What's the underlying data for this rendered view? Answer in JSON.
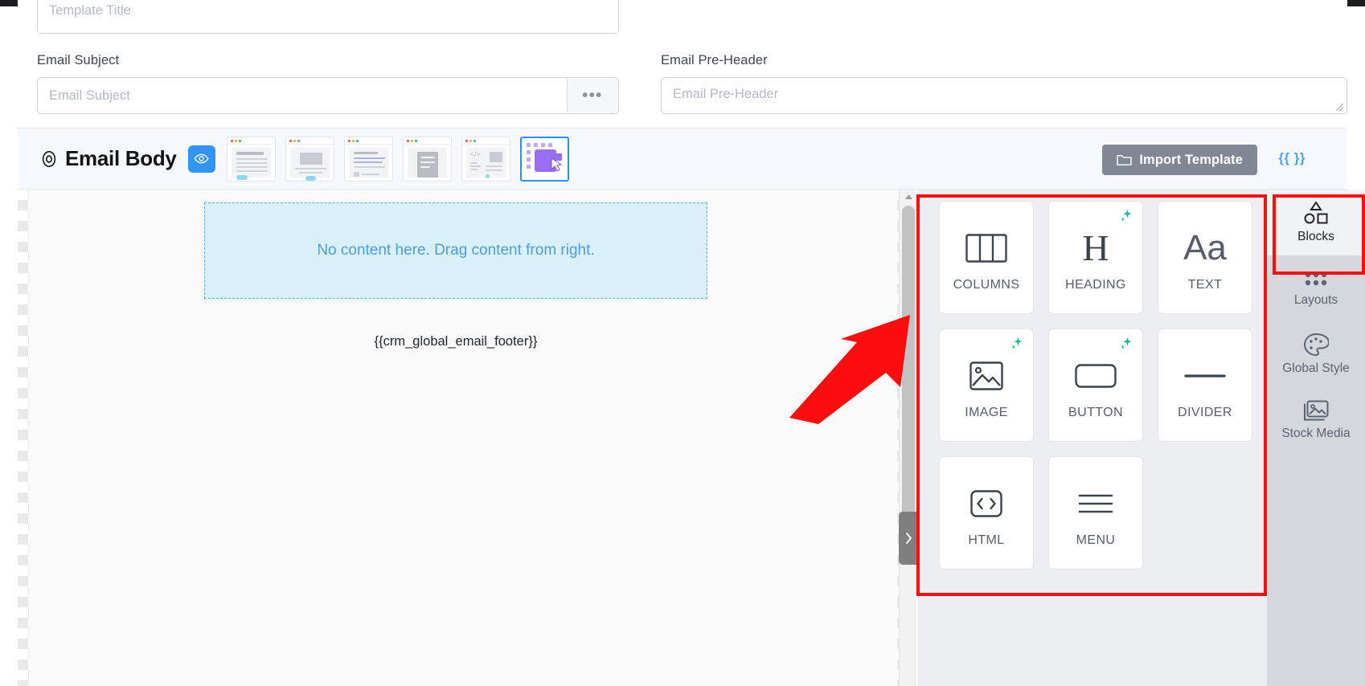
{
  "form": {
    "template_title": {
      "placeholder": "Template Title",
      "value": ""
    },
    "email_subject": {
      "label": "Email Subject",
      "placeholder": "Email Subject",
      "value": "",
      "more_button": "•••"
    },
    "email_preheader": {
      "label": "Email Pre-Header",
      "placeholder": "Email Pre-Header",
      "value": ""
    }
  },
  "body_bar": {
    "title": "Email Body",
    "preview_icon": "eye-icon",
    "target_icon": "target-icon",
    "import_button": "Import Template",
    "merge_tags": "{{ }}",
    "templates": [
      {
        "name": "text-template",
        "selected": false
      },
      {
        "name": "image-template",
        "selected": false
      },
      {
        "name": "article-template",
        "selected": false
      },
      {
        "name": "document-template",
        "selected": false
      },
      {
        "name": "html-template",
        "selected": false
      },
      {
        "name": "drag-drop-builder",
        "selected": true
      }
    ]
  },
  "canvas": {
    "drop_zone_text": "No content here. Drag content from right.",
    "footer_token": "{{crm_global_email_footer}}",
    "collapse_handle_icon": "chevron-right-icon"
  },
  "blocks_panel": {
    "blocks": [
      {
        "label": "COLUMNS",
        "icon": "columns-icon",
        "ai": false
      },
      {
        "label": "HEADING",
        "icon": "heading-icon",
        "ai": true
      },
      {
        "label": "TEXT",
        "icon": "text-aa-icon",
        "ai": false
      },
      {
        "label": "IMAGE",
        "icon": "image-icon",
        "ai": true
      },
      {
        "label": "BUTTON",
        "icon": "button-icon",
        "ai": true
      },
      {
        "label": "DIVIDER",
        "icon": "divider-icon",
        "ai": false
      },
      {
        "label": "HTML",
        "icon": "code-icon",
        "ai": false
      },
      {
        "label": "MENU",
        "icon": "menu-icon",
        "ai": false
      }
    ]
  },
  "tab_rail": {
    "items": [
      {
        "label": "Blocks",
        "icon": "shapes-icon",
        "active": true
      },
      {
        "label": "Layouts",
        "icon": "grid-dots-icon",
        "active": false
      },
      {
        "label": "Global Style",
        "icon": "palette-icon",
        "active": false
      },
      {
        "label": "Stock Media",
        "icon": "stock-media-icon",
        "active": false
      }
    ]
  },
  "annotations": {
    "highlight_color": "#fd0d0d",
    "arrow": "points from canvas toward blocks panel"
  },
  "colors": {
    "accent_blue": "#3394f5",
    "panel_bg": "#eceef1",
    "rail_bg": "#d4d7dc",
    "import_btn": "#808893",
    "sparkle_green": "#17b79a"
  }
}
